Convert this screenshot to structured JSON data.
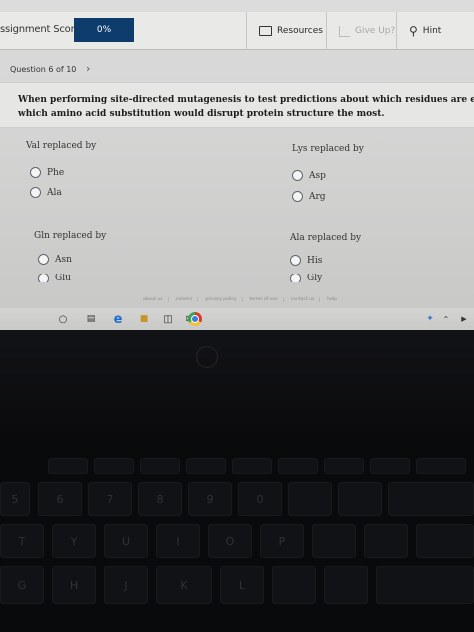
{
  "header": {
    "score_label": "ssignment Score:",
    "score_value": "0%",
    "resources_label": "Resources",
    "giveup_label": "Give Up?",
    "hint_label": "Hint"
  },
  "question_nav": {
    "label": "Question 6 of 10",
    "next_icon": "chevron-right-icon"
  },
  "question": {
    "line1": "When performing site-directed mutagenesis to test predictions about which residues are essential for protei",
    "line2": "which amino acid substitution would disrupt protein structure the most."
  },
  "groups": [
    {
      "title": "Val replaced by",
      "options": [
        "Phe",
        "Ala"
      ]
    },
    {
      "title": "Lys replaced by",
      "options": [
        "Asp",
        "Arg"
      ]
    },
    {
      "title": "Gln replaced by",
      "options": [
        "Asn",
        "Glu"
      ]
    },
    {
      "title": "Ala replaced by",
      "options": [
        "His",
        "Gly"
      ]
    }
  ],
  "footer_links": [
    "about us",
    "careers",
    "privacy policy",
    "terms of use",
    "contact us",
    "help"
  ],
  "taskbar": {
    "icons": [
      "search-icon",
      "task-view-icon",
      "edge-icon",
      "file-explorer-icon",
      "store-icon",
      "mail-icon",
      "chrome-icon"
    ],
    "tray": [
      "network-icon",
      "chevron-up-icon",
      "volume-icon"
    ]
  },
  "keyboard": {
    "row_numbers": [
      "5",
      "6",
      "7",
      "8",
      "9",
      "0"
    ],
    "row_top": [
      "T",
      "Y",
      "U",
      "I",
      "O",
      "P"
    ],
    "row_home": [
      "G",
      "H",
      "J",
      "K",
      "L"
    ]
  }
}
